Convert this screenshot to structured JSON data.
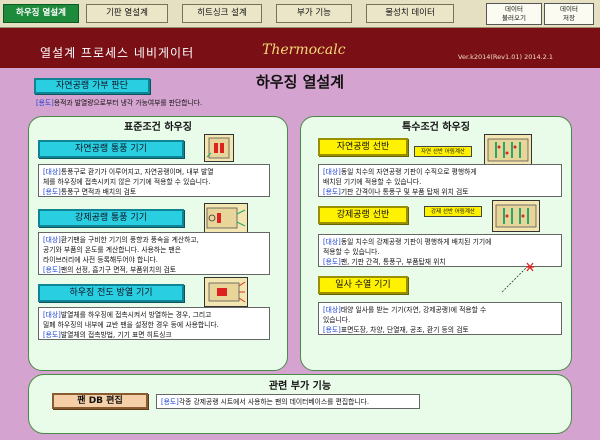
{
  "nav": {
    "tabs": [
      "하우징 열설계",
      "기판 열설계",
      "히트싱크 설계",
      "부가 기능",
      "물성치 데이터"
    ],
    "load_btn": [
      "데이터",
      "불러오기"
    ],
    "save_btn": [
      "데이터",
      "저장"
    ]
  },
  "header": {
    "title": "열설계 프로세스 네비게이터",
    "brand": "Thermocalc",
    "version": "Ver.k2014(Rev1.01)   2014.2.1"
  },
  "page": {
    "title": "하우징 열설계",
    "check_button": "자연공랭 가부 판단",
    "check_tag": "[용도]",
    "check_desc": "용적과 발열량으로부터 냉각 가능여부를 판단합니다."
  },
  "standard": {
    "heading": "표준조건 하우징",
    "items": [
      {
        "button": "자연공랭 통풍 기기",
        "lines": [
          {
            "tag": "[대상]",
            "text": "통풍구로 환기가 이루어지고, 자연공랭이며, 내부 발열"
          },
          {
            "tag": "",
            "text": "체를 하우징에 접촉시키지 않은 기기에 적용할 수 있습니다."
          },
          {
            "tag": "[용도]",
            "text": "통풍구 면적과 배치의 검토"
          }
        ]
      },
      {
        "button": "강제공랭 통풍 기기",
        "lines": [
          {
            "tag": "[대상]",
            "text": "환기팬을 구비한 기기의 풍향과 풍속을 계산하고,"
          },
          {
            "tag": "",
            "text": "공기와 부품의 온도를 계산합니다. 사용하는 팬은"
          },
          {
            "tag": "",
            "text": "라이브러리에 사전 등록해두어야 합니다."
          },
          {
            "tag": "[용도]",
            "text": "팬의 선정, 흡기구 면적, 부품위치의 검토"
          }
        ]
      },
      {
        "button": "하우징 전도 방열 기기",
        "lines": [
          {
            "tag": "[대상]",
            "text": "발열체를 하우징에 접촉시켜서 방열하는 경우, 그리고"
          },
          {
            "tag": "",
            "text": "밀폐 하우징의 내부에 교반 팬을 설정한 경우 등에 사용합니다."
          },
          {
            "tag": "[용도]",
            "text": "발열체의 접촉방법, 기기 표면 히트싱크"
          }
        ]
      }
    ]
  },
  "special": {
    "heading": "특수조건 하우징",
    "items": [
      {
        "button": "자연공랭 선반",
        "tag": "자연 선반 어림계산",
        "lines": [
          {
            "tag": "[대상]",
            "text": "동일 치수의 자연공랭 기판이 수직으로 평행하게"
          },
          {
            "tag": "",
            "text": "배치된 기기에 적용할 수 있습니다."
          },
          {
            "tag": "[용도]",
            "text": "기판 간격이나 통풍구 및 부품 탑재 위치 검토"
          }
        ]
      },
      {
        "button": "강제공랭 선반",
        "tag": "강제 선반 어림계산",
        "lines": [
          {
            "tag": "[대상]",
            "text": "동일 치수의 강제공랭 기판이 평행하게 배치된 기기에"
          },
          {
            "tag": "",
            "text": "적용할 수 있습니다."
          },
          {
            "tag": "[용도]",
            "text": "팬, 기판 간격, 통풍구, 부품탑재 위치"
          }
        ]
      },
      {
        "button": "일사 수열 기기",
        "lines": [
          {
            "tag": "[대상]",
            "text": "태양 일사를 받는 기기(자연, 강제공랭)에 적용할 수"
          },
          {
            "tag": "",
            "text": "있습니다."
          },
          {
            "tag": "[용도]",
            "text": "표면도장, 차양, 단열재, 공조, 환기 등의 검토"
          }
        ]
      }
    ]
  },
  "related": {
    "heading": "관련 부가 기능",
    "button": "팬 DB 편집",
    "tag": "[용도]",
    "desc": "각종 강제공랭 시트에서 사용하는 팬의 데이터베이스를 편집합니다."
  },
  "colors": {
    "header_bg": "#7a0f16",
    "main_bg": "#d5a3cf",
    "panel_bg": "#e9fce9",
    "active_tab": "#1e8a3c",
    "cyan_button": "#29cfe0",
    "yellow_button": "#fff200",
    "tag_blue": "#1a3fd4"
  }
}
